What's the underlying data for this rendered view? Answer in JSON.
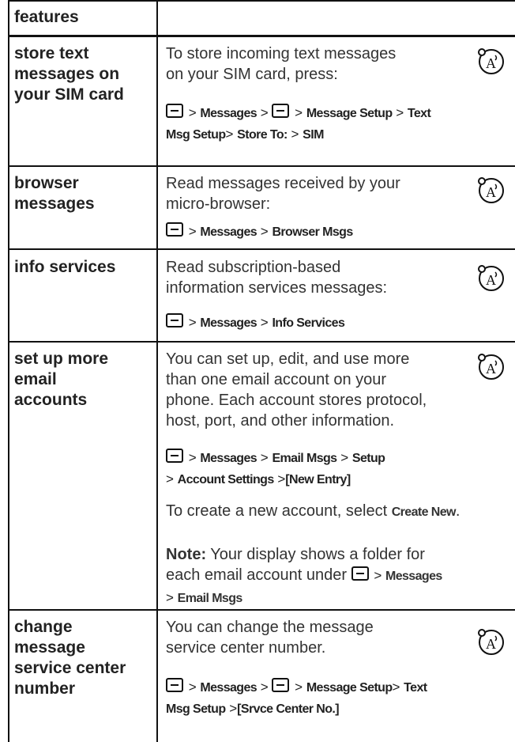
{
  "header": {
    "label": "features"
  },
  "rows": [
    {
      "feature": [
        "store text",
        "messages on",
        "your SIM card"
      ],
      "desc": [
        "To store incoming text messages",
        "on your SIM card, press:"
      ],
      "path": [
        [
          "M",
          " > ",
          "Messages",
          " > ",
          "M",
          " > ",
          "Message Setup",
          " > ",
          "Text"
        ],
        [
          "Msg Setup",
          "> ",
          "Store To:",
          " > ",
          "SIM"
        ]
      ]
    },
    {
      "feature": [
        "browser",
        "messages"
      ],
      "desc": [
        "Read messages received by your",
        "micro-browser:"
      ],
      "path": [
        [
          "M",
          " > ",
          "Messages",
          " > ",
          "Browser Msgs"
        ]
      ]
    },
    {
      "feature": [
        "info services"
      ],
      "desc": [
        "Read subscription-based",
        "information services messages:"
      ],
      "path": [
        [
          "M",
          " > ",
          "Messages",
          " > ",
          "Info Services"
        ]
      ]
    },
    {
      "feature": [
        "set up more",
        "email",
        "accounts"
      ],
      "desc": [
        "You can set up, edit, and use more",
        "than one email account on your",
        "phone. Each account stores protocol,",
        "host, port, and other information."
      ],
      "path": [
        [
          "M",
          " > ",
          "Messages",
          "  > ",
          "Email Msgs",
          " > ",
          "Setup"
        ],
        [
          "> ",
          "Account Settings",
          " >",
          "[New Entry]"
        ]
      ],
      "extra1": {
        "before": "To create a new account, select ",
        "bold": "Create New",
        "after": "."
      },
      "note": {
        "label": "Note:",
        "text1": " Your display shows a folder for",
        "text2": "each email account under ",
        "path_end": "Messages",
        "line3a": "> ",
        "line3b": "Email Msgs"
      }
    },
    {
      "feature": [
        "change",
        "message",
        "service center",
        "number"
      ],
      "desc": [
        "You can change the message",
        "service center number."
      ],
      "path": [
        [
          "M",
          " > ",
          "Messages",
          "  > ",
          "M",
          " > ",
          "Message Setup",
          "> ",
          "Text"
        ],
        [
          "Msg Setup",
          " >",
          "[Srvce Center No.]"
        ]
      ]
    }
  ]
}
